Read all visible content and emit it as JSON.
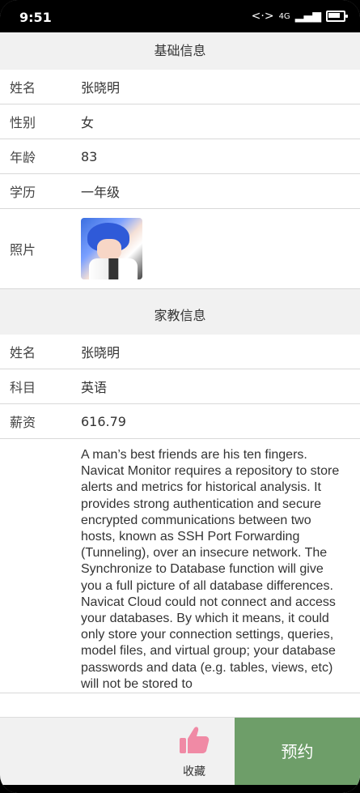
{
  "status_bar": {
    "time": "9:51",
    "network": "4G"
  },
  "basic_info": {
    "section_title": "基础信息",
    "rows": [
      {
        "label": "姓名",
        "value": "张晓明"
      },
      {
        "label": "性别",
        "value": "女"
      },
      {
        "label": "年龄",
        "value": "83"
      },
      {
        "label": "学历",
        "value": "一年级"
      }
    ],
    "photo_label": "照片"
  },
  "tutor_info": {
    "section_title": "家教信息",
    "rows": [
      {
        "label": "姓名",
        "value": "张晓明"
      },
      {
        "label": "科目",
        "value": "英语"
      },
      {
        "label": "薪资",
        "value": "616.79"
      }
    ],
    "description": "A man’s best friends are his ten fingers. Navicat Monitor requires a repository to store alerts and metrics for historical analysis. It provides strong authentication and secure encrypted communications between two hosts, known as SSH Port Forwarding (Tunneling), over an insecure network. The Synchronize to Database function will give you a full picture of all database differences. Navicat Cloud could not connect and access your databases. By which it means, it could only store your connection settings, queries, model files, and virtual group; your database passwords and data (e.g. tables, views, etc) will not be stored to"
  },
  "bottom_bar": {
    "favorite_label": "收藏",
    "book_label": "预约",
    "icon": "thumbs-up-icon",
    "colors": {
      "book_button": "#6e9e69",
      "thumb": "#f08aa5"
    }
  }
}
